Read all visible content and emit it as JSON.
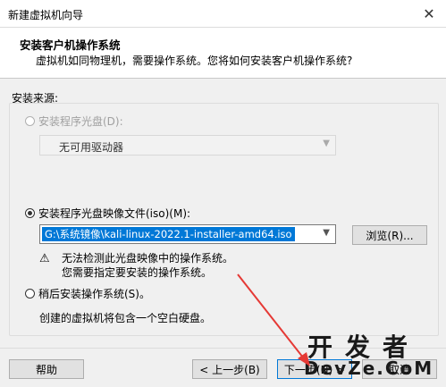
{
  "window": {
    "title": "新建虚拟机向导",
    "close_glyph": "✕"
  },
  "header": {
    "title": "安装客户机操作系统",
    "subtitle": "虚拟机如同物理机，需要操作系统。您将如何安装客户机操作系统?"
  },
  "source": {
    "label": "安装来源:",
    "disc_option": {
      "label": "安装程序光盘(D):",
      "selected": false,
      "enabled": false
    },
    "disc_dropdown": {
      "value": "无可用驱动器"
    },
    "iso_option": {
      "label": "安装程序光盘映像文件(iso)(M):",
      "selected": true
    },
    "iso_path": "G:\\系统镜像\\kali-linux-2022.1-installer-amd64.iso",
    "browse_label": "浏览(R)...",
    "warning_icon": "warning-icon",
    "warning_line1": "无法检测此光盘映像中的操作系统。",
    "warning_line2": "您需要指定要安装的操作系统。",
    "later_option": {
      "label": "稍后安装操作系统(S)。",
      "selected": false
    },
    "later_desc": "创建的虚拟机将包含一个空白硬盘。"
  },
  "footer": {
    "help_label": "帮助",
    "back_label": "< 上一步(B)",
    "next_label": "下一步(N) >",
    "cancel_label": "取消"
  },
  "watermark": {
    "line1": "开发者",
    "line2": "DevZe.CoM"
  },
  "colors": {
    "selection": "#0078d7",
    "annotation_arrow": "#e53935"
  }
}
